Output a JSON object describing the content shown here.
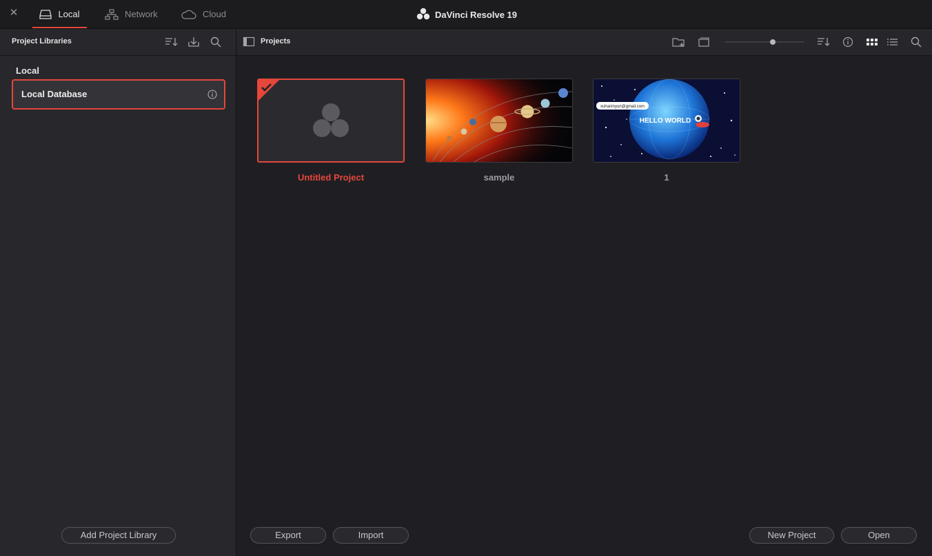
{
  "topbar": {
    "tabs": [
      {
        "label": "Local",
        "icon": "drive-icon",
        "active": true
      },
      {
        "label": "Network",
        "icon": "network-icon",
        "active": false
      },
      {
        "label": "Cloud",
        "icon": "cloud-icon",
        "active": false
      }
    ],
    "app_title": "DaVinci Resolve 19"
  },
  "sidebar": {
    "title": "Project Libraries",
    "section_label": "Local",
    "database": {
      "label": "Local Database",
      "selected": true
    },
    "add_button": "Add Project Library"
  },
  "main": {
    "title": "Projects",
    "thumbnail_size_level": 0.6,
    "projects": [
      {
        "name": "Untitled Project",
        "selected": true,
        "thumbnail": "resolve-logo-placeholder"
      },
      {
        "name": "sample",
        "selected": false,
        "thumbnail": "solar-system-image"
      },
      {
        "name": "1",
        "selected": false,
        "thumbnail": "hello-world-globe-image"
      }
    ],
    "thumb_overlay": {
      "email": "xuhaninyun@gmail.com",
      "text": "HELLO WORLD"
    },
    "buttons": {
      "export": "Export",
      "import": "Import",
      "new_project": "New Project",
      "open": "Open"
    }
  },
  "colors": {
    "accent": "#e5473a",
    "panel": "#28282c",
    "background": "#1f1f23"
  }
}
